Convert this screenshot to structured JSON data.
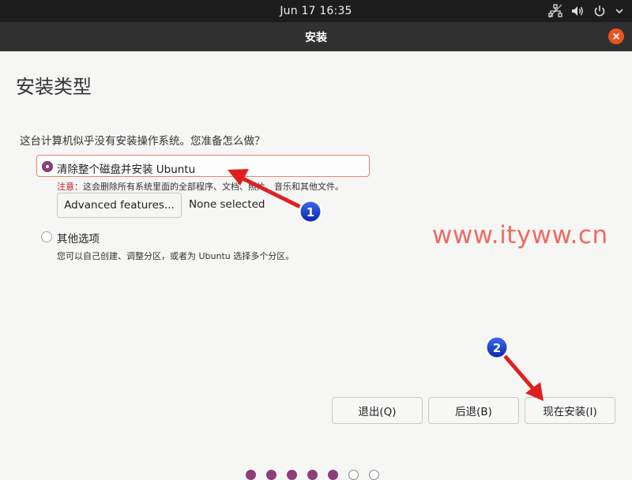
{
  "topbar": {
    "clock": "Jun 17  16:35",
    "tray_icons": [
      "network-icon",
      "volume-icon",
      "power-icon",
      "chevron-down-icon"
    ]
  },
  "window": {
    "title": "安装"
  },
  "page": {
    "heading": "安装类型",
    "question": "这台计算机似乎没有安装操作系统。您准备怎么做？"
  },
  "options": {
    "erase_disk": {
      "label": "清除整个磁盘并安装 Ubuntu",
      "selected": true,
      "note_prefix": "注意：",
      "note_text": "这会删除所有系统里面的全部程序、文档、照片、音乐和其他文件。",
      "advanced_button": "Advanced features...",
      "advanced_status": "None selected"
    },
    "other": {
      "label": "其他选项",
      "selected": false,
      "description": "您可以自己创建、调整分区，或者为 Ubuntu 选择多个分区。"
    }
  },
  "buttons": {
    "quit": "退出(Q)",
    "back": "后退(B)",
    "install": "现在安装(I)"
  },
  "progress": {
    "total_steps": 7,
    "completed_steps": 5
  },
  "annotations": {
    "badge1": "1",
    "badge2": "2",
    "watermark": "www.ityww.cn"
  },
  "colors": {
    "accent": "#e95420",
    "radio_selected": "#8c3e7a",
    "arrow": "#e02020",
    "badge": "#1a3fc8",
    "watermark": "#ee6b63"
  }
}
